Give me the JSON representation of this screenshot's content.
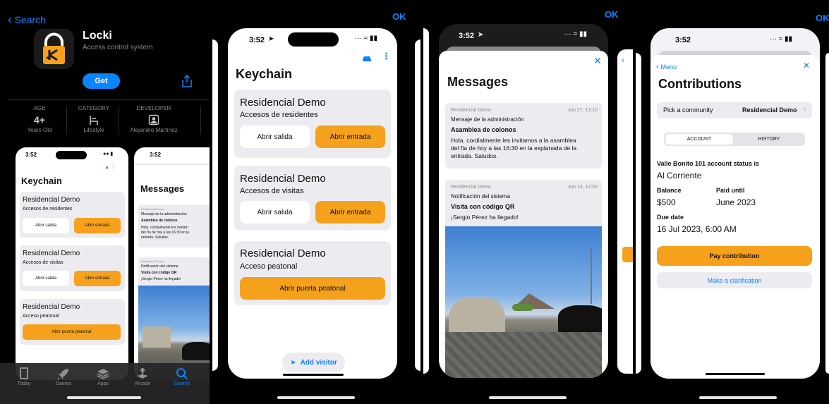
{
  "store": {
    "back_label": "Search",
    "app_name": "Locki",
    "subtitle": "Access control system",
    "get_label": "Get",
    "info": [
      {
        "label": "AGE",
        "value": "4+",
        "sub": "Years Old"
      },
      {
        "label": "CATEGORY",
        "value": "",
        "sub": "Lifestyle"
      },
      {
        "label": "DEVELOPER",
        "value": "",
        "sub": "Alejandro Martínez"
      }
    ],
    "tabs": [
      {
        "label": "Today",
        "icon": "today-icon"
      },
      {
        "label": "Games",
        "icon": "rocket-icon"
      },
      {
        "label": "Apps",
        "icon": "layers-icon"
      },
      {
        "label": "Arcade",
        "icon": "joystick-icon"
      },
      {
        "label": "Search",
        "icon": "search-icon",
        "active": true
      }
    ],
    "colors": {
      "accent": "#0a84ff",
      "brand": "#f6a11b"
    }
  },
  "status": {
    "time": "3:52",
    "time_plain": "3:52"
  },
  "ok_label": "OK",
  "keychain": {
    "title": "Keychain",
    "cards": [
      {
        "title": "Residencial Demo",
        "subtitle": "Accesos de residentes",
        "left": "Abrir salida",
        "right": "Abrir entrada"
      },
      {
        "title": "Residencial Demo",
        "subtitle": "Accesos de visitas",
        "left": "Abrir salida",
        "right": "Abrir entrada"
      },
      {
        "title": "Residencial Demo",
        "subtitle": "Acceso peatonal",
        "single": "Abrir puerta peatonal"
      }
    ],
    "add_visitor": "Add visitor"
  },
  "messages": {
    "title": "Messages",
    "items": [
      {
        "source": "Residencial Demo",
        "date": "Jun 27, 13:10",
        "kind": "Mensaje de la administración",
        "heading": "Asamblea de colonos",
        "line1": "Hola, cordialmente les invitamos a la asamblea",
        "line2": "del fía de hoy a las 16:30 en la explanada de la",
        "line3": "entrada. Saludos."
      },
      {
        "source": "Residencial Demo",
        "date": "Jun 14, 12:50",
        "kind": "Notificación del sistema",
        "heading": "Visita con código QR",
        "line1": "¡Sergio Pérez ha llegado!"
      }
    ],
    "mini_item1_line1": "Hola, cordialmente les invitam",
    "mini_item1_line2": "del fía de hoy a las 16:30 en la",
    "mini_item1_line3": "entrada. Saludos."
  },
  "contrib": {
    "back": "Menu",
    "title": "Contributions",
    "pick_label": "Pick a community",
    "pick_value": "Residencial Demo",
    "seg": [
      "ACCOUNT",
      "HISTORY"
    ],
    "status_label": "Valle Bonito 101 account status is",
    "status_value": "Al Corriente",
    "balance_label": "Balance",
    "balance_value": "$500",
    "paid_label": "Paid until",
    "paid_value": "June 2023",
    "due_label": "Due date",
    "due_value": "16 Jul 2023, 6:00 AM",
    "pay": "Pay contribution",
    "clarify": "Make a clarification"
  }
}
